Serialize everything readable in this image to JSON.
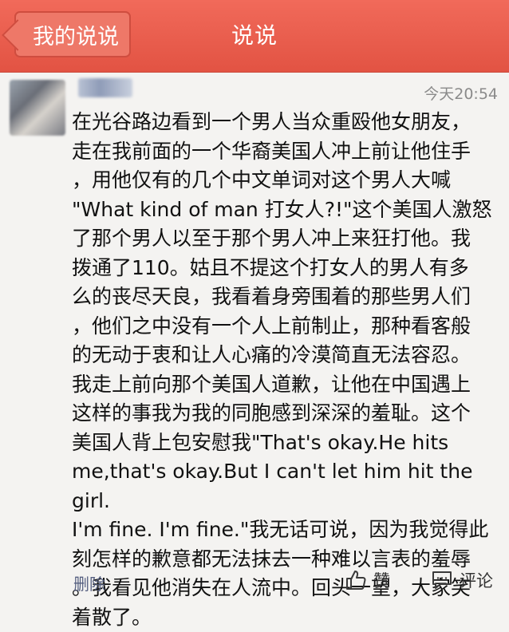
{
  "header": {
    "back_label": "我的说说",
    "title": "说说"
  },
  "post": {
    "timestamp": "今天20:54",
    "text": "在光谷路边看到一个男人当众重殴他女朋友，\n走在我前面的一个华裔美国人冲上前让他住手\n，用他仅有的几个中文单词对这个男人大喊\n\"What kind of man 打女人?!\"这个美国人激怒\n了那个男人以至于那个男人冲上来狂打他。我\n拨通了110。姑且不提这个打女人的男人有多\n么的丧尽天良，我看着身旁围着的那些男人们\n，他们之中没有一个人上前制止，那种看客般\n的无动于衷和让人心痛的冷漠简直无法容忍。\n我走上前向那个美国人道歉，让他在中国遇上\n这样的事我为我的同胞感到深深的羞耻。这个\n美国人背上包安慰我\"That's okay.He hits\nme,that's okay.But I can't let him hit the girl.\nI'm fine. I'm fine.\"我无话可说，因为我觉得此\n刻怎样的歉意都无法抹去一种难以言表的羞辱\n。我看见他消失在人流中。回头一望，大家笑\n着散了。"
  },
  "actions": {
    "delete_label": "删除",
    "like_label": "赞",
    "comment_label": "评论"
  },
  "icons": {
    "like": "thumbs-up-icon",
    "comment": "comment-bubble-icon"
  },
  "colors": {
    "header_bg": "#e9594a",
    "delete_link": "#555f80"
  }
}
